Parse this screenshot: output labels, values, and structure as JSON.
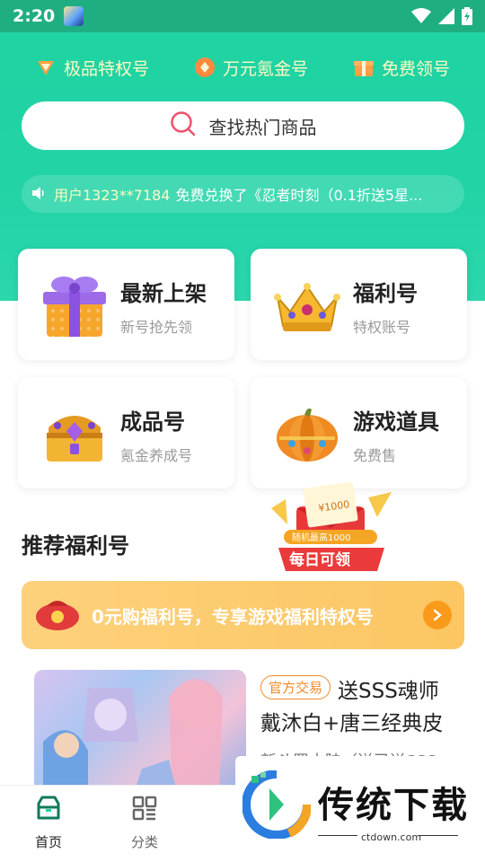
{
  "status_bar": {
    "time": "2:20"
  },
  "privileges": [
    {
      "label": "极品特权号",
      "icon": "diamond-heart-icon"
    },
    {
      "label": "万元氪金号",
      "icon": "coin-diamond-icon"
    },
    {
      "label": "免费领号",
      "icon": "gift-box-icon"
    }
  ],
  "search": {
    "placeholder": "查找热门商品"
  },
  "notice": {
    "user": "用户1323**7184",
    "text": "免费兑换了《忍者时刻（0.1折送5星..."
  },
  "categories": [
    {
      "title": "最新上架",
      "subtitle": "新号抢先领",
      "icon": "gift-box-icon"
    },
    {
      "title": "福利号",
      "subtitle": "特权账号",
      "icon": "crown-icon"
    },
    {
      "title": "成品号",
      "subtitle": "氪金养成号",
      "icon": "treasure-chest-icon"
    },
    {
      "title": "游戏道具",
      "subtitle": "免费售",
      "icon": "pumpkin-icon"
    }
  ],
  "daily_promo": {
    "voucher": "¥1000",
    "ribbon": "随机最高1000",
    "label": "每日可领"
  },
  "section": {
    "title": "推荐福利号"
  },
  "banner": {
    "text": "0元购福利号，专享游戏福利特权号"
  },
  "product": {
    "tag": "官方交易",
    "title_line1": "送SSS魂师",
    "title_line2": "戴沐白+唐三经典皮",
    "desc": "新斗罗大陆（送已送SSS"
  },
  "bottom_nav": [
    {
      "label": "首页",
      "icon": "store-icon",
      "active": true
    },
    {
      "label": "分类",
      "icon": "grid-icon",
      "active": false
    }
  ],
  "watermark": {
    "text": "传统下载",
    "url": "ctdown.com"
  },
  "colors": {
    "accent": "#1fd3a1",
    "gold": "#fff9c4",
    "orange": "#f99a1b"
  }
}
